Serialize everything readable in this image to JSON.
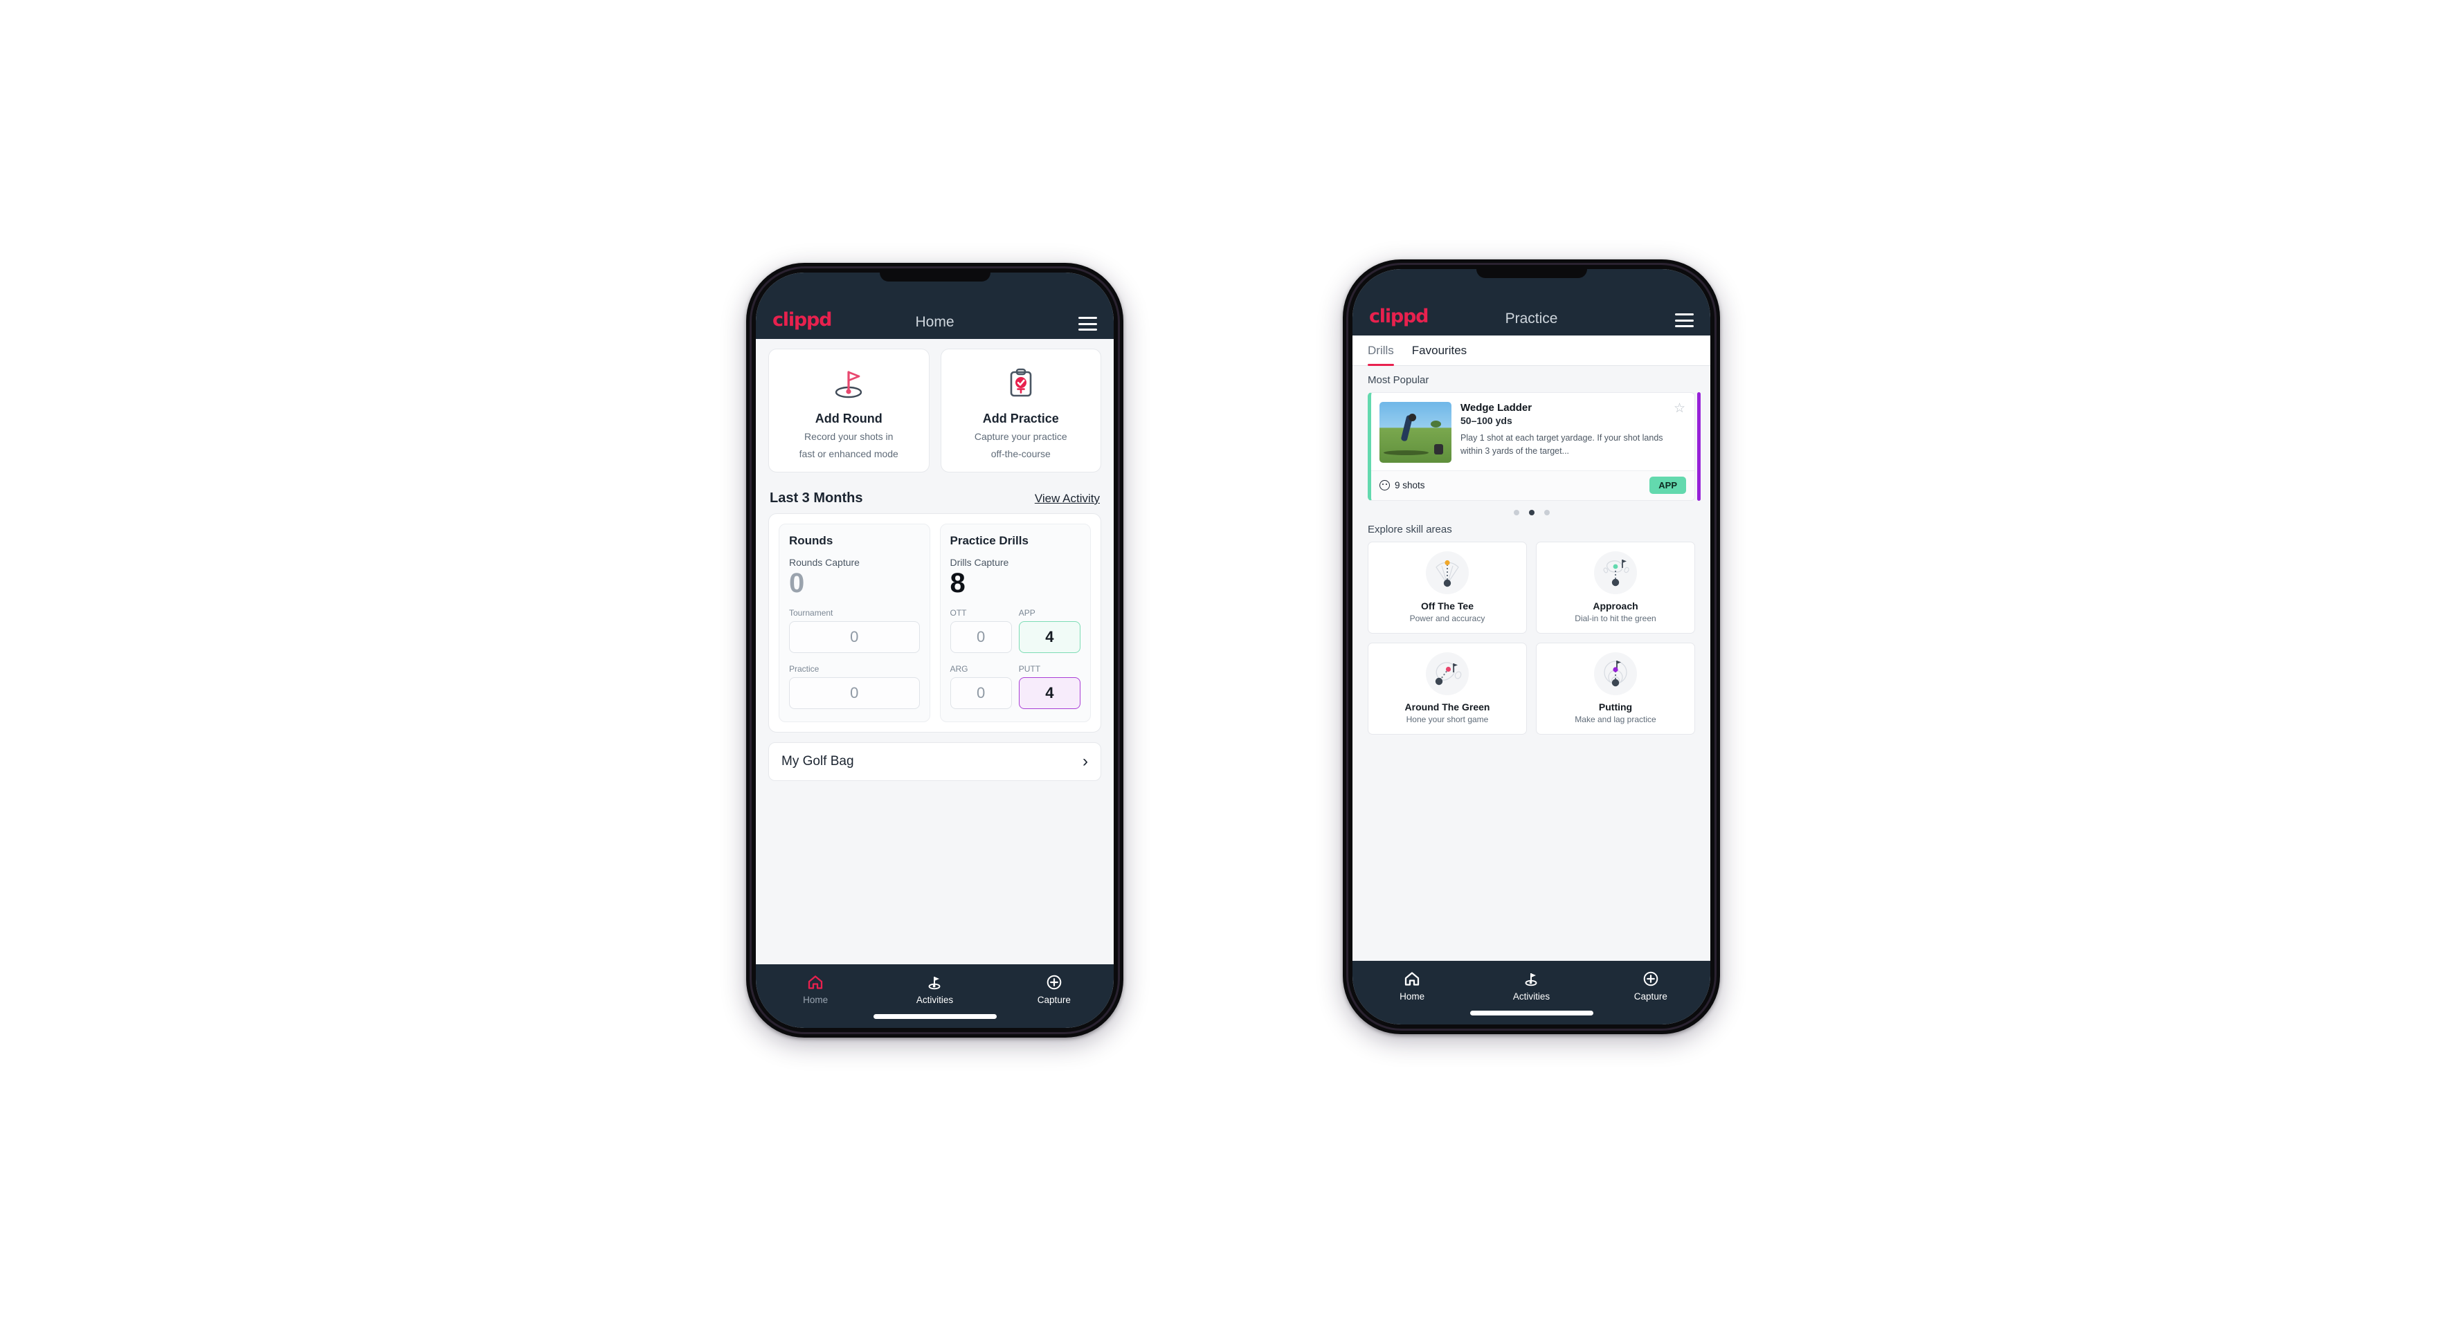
{
  "brand": {
    "name": "clippd",
    "accent": "#e8214e",
    "appbar_bg": "#1e2b38",
    "green": "#63d9ae",
    "purple": "#9722d8"
  },
  "phone_home": {
    "appbar": {
      "title": "Home",
      "menu_icon": "hamburger-menu-icon"
    },
    "actions": [
      {
        "icon": "golf-flag-icon",
        "title": "Add Round",
        "subtitle_line1": "Record your shots in",
        "subtitle_line2": "fast or enhanced mode"
      },
      {
        "icon": "clipboard-check-icon",
        "title": "Add Practice",
        "subtitle_line1": "Capture your practice",
        "subtitle_line2": "off-the-course"
      }
    ],
    "section": {
      "title": "Last 3 Months",
      "link": "View Activity"
    },
    "rounds": {
      "heading": "Rounds",
      "capture_label": "Rounds Capture",
      "capture_value": "0",
      "fields": [
        {
          "label": "Tournament",
          "value": "0",
          "state": "empty"
        },
        {
          "label": "Practice",
          "value": "0",
          "state": "empty"
        }
      ]
    },
    "drills": {
      "heading": "Practice Drills",
      "capture_label": "Drills Capture",
      "capture_value": "8",
      "fields": [
        {
          "label": "OTT",
          "value": "0",
          "state": "empty"
        },
        {
          "label": "APP",
          "value": "4",
          "state": "green"
        },
        {
          "label": "ARG",
          "value": "0",
          "state": "empty"
        },
        {
          "label": "PUTT",
          "value": "4",
          "state": "purple"
        }
      ]
    },
    "golf_bag": {
      "label": "My Golf Bag",
      "chevron": "chevron-right-icon"
    },
    "bottom_nav": [
      {
        "label": "Home",
        "icon": "home-icon",
        "active": true
      },
      {
        "label": "Activities",
        "icon": "golf-flag-icon",
        "active": false
      },
      {
        "label": "Capture",
        "icon": "plus-circle-icon",
        "active": false
      }
    ]
  },
  "phone_practice": {
    "appbar": {
      "title": "Practice",
      "menu_icon": "hamburger-menu-icon"
    },
    "tabs": [
      {
        "label": "Drills",
        "active": true
      },
      {
        "label": "Favourites",
        "active": false
      }
    ],
    "most_popular_heading": "Most Popular",
    "drill": {
      "title": "Wedge Ladder",
      "yardage": "50–100 yds",
      "description": "Play 1 shot at each target yardage. If your shot lands within 3 yards of the target...",
      "shots": "9 shots",
      "badge": "APP",
      "star_icon": "star-outline-icon",
      "shots_icon": "golf-ball-icon",
      "accent_left": "#63d9ae",
      "peek_accent": "#9722d8"
    },
    "carousel_dots": {
      "count": 3,
      "active_index": 1
    },
    "skill_heading": "Explore skill areas",
    "skills": [
      {
        "name": "Off The Tee",
        "sub": "Power and accuracy",
        "icon": "tee-fan-icon",
        "dot_color": "#f0a72a"
      },
      {
        "name": "Approach",
        "sub": "Dial-in to hit the green",
        "icon": "green-approach-icon",
        "dot_color": "#63d9ae"
      },
      {
        "name": "Around The Green",
        "sub": "Hone your short game",
        "icon": "chip-green-icon",
        "dot_color": "#e8456c"
      },
      {
        "name": "Putting",
        "sub": "Make and lag practice",
        "icon": "putting-rings-icon",
        "dot_color": "#9722d8"
      }
    ],
    "bottom_nav": [
      {
        "label": "Home",
        "icon": "home-icon",
        "active": false
      },
      {
        "label": "Activities",
        "icon": "golf-flag-icon",
        "active": true
      },
      {
        "label": "Capture",
        "icon": "plus-circle-icon",
        "active": false
      }
    ]
  }
}
